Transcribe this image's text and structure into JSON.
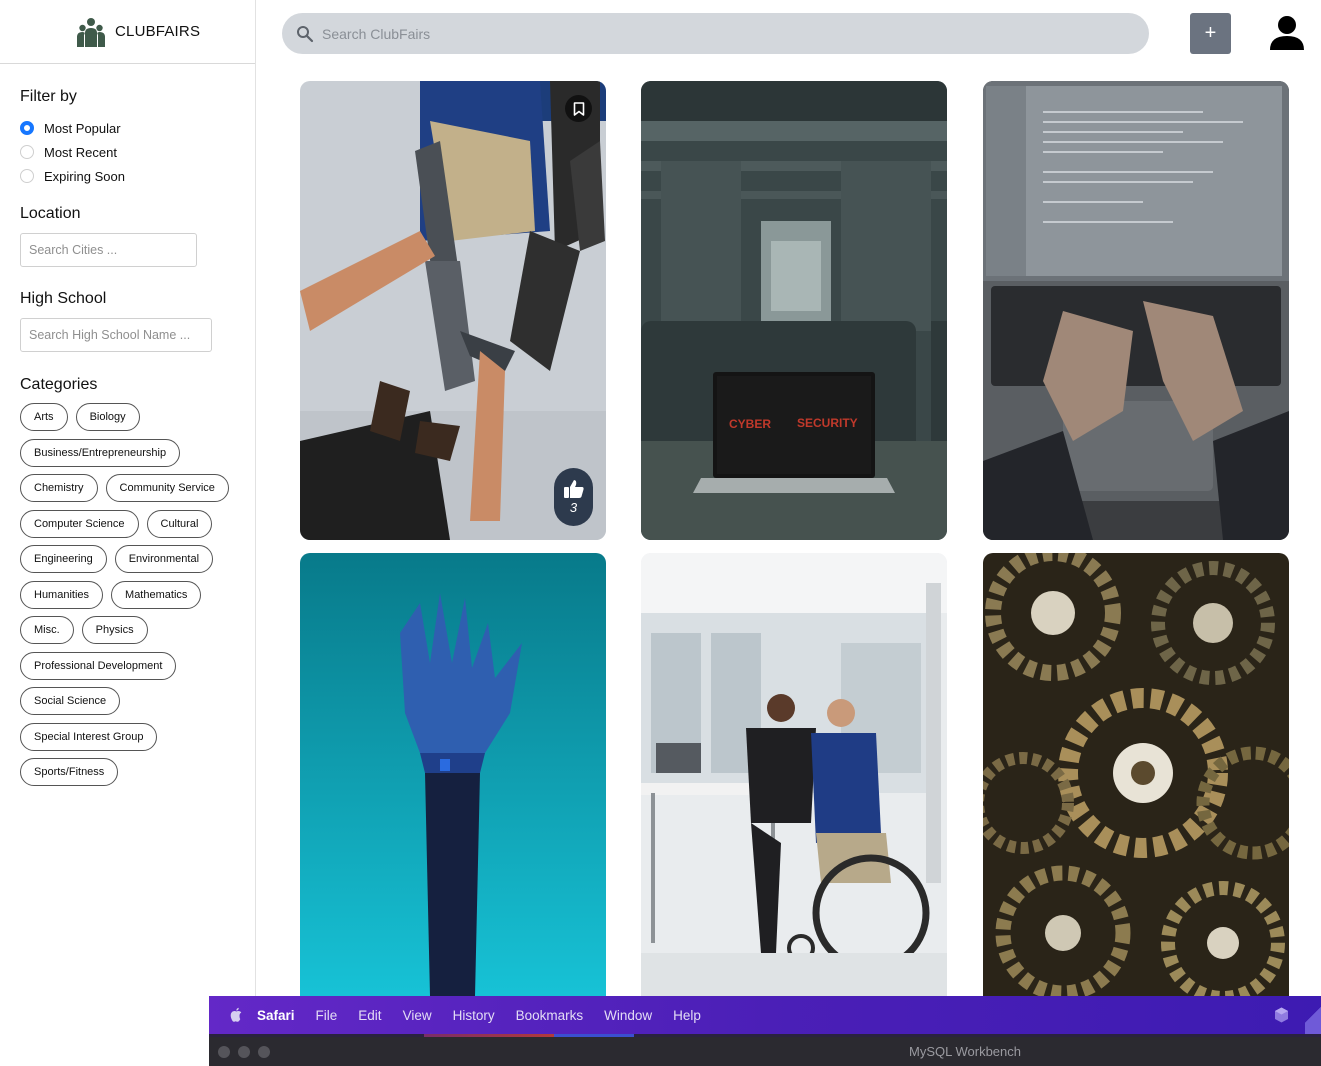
{
  "brand": {
    "name": "CLUBFAIRS",
    "logo_icon": "people-group-icon"
  },
  "filter": {
    "title": "Filter by",
    "options": [
      {
        "label": "Most Popular",
        "checked": true
      },
      {
        "label": "Most Recent",
        "checked": false
      },
      {
        "label": "Expiring Soon",
        "checked": false
      }
    ]
  },
  "location": {
    "title": "Location",
    "placeholder": "Search Cities ..."
  },
  "high_school": {
    "title": "High School",
    "placeholder": "Search High School Name ..."
  },
  "categories": {
    "title": "Categories",
    "items": [
      "Arts",
      "Biology",
      "Business/Entrepreneurship",
      "Chemistry",
      "Community Service",
      "Computer Science",
      "Cultural",
      "Engineering",
      "Environmental",
      "Humanities",
      "Mathematics",
      "Misc.",
      "Physics",
      "Professional Development",
      "Social Science",
      "Special Interest Group",
      "Sports/Fitness"
    ]
  },
  "search": {
    "placeholder": "Search ClubFairs",
    "icon": "search-icon"
  },
  "header": {
    "add_label": "+",
    "user_icon": "user-icon"
  },
  "cards": [
    {
      "image": "prosthetic-arm-handshake",
      "like_count": "3",
      "bookmark_icon": "bookmark-icon",
      "like_icon": "thumbs-up-icon",
      "screen_text": ""
    },
    {
      "image": "cyber-security-laptop",
      "screen_text_left": "CYBER",
      "screen_text_right": "SECURITY"
    },
    {
      "image": "laptop-typing-code"
    },
    {
      "image": "robotic-hand-blue"
    },
    {
      "image": "wheelchair-prosthetic-office"
    },
    {
      "image": "gears-cogs"
    }
  ],
  "mac_menu": {
    "app": "Safari",
    "items": [
      "File",
      "Edit",
      "View",
      "History",
      "Bookmarks",
      "Window",
      "Help"
    ]
  },
  "window": {
    "title": "MySQL Workbench"
  },
  "colors": {
    "accent": "#1677ff",
    "search_bg": "#d3d7dc",
    "add_button": "#6b7380",
    "like_bg": "#2d3a4d",
    "menu_bar": "#4b1fb7"
  }
}
